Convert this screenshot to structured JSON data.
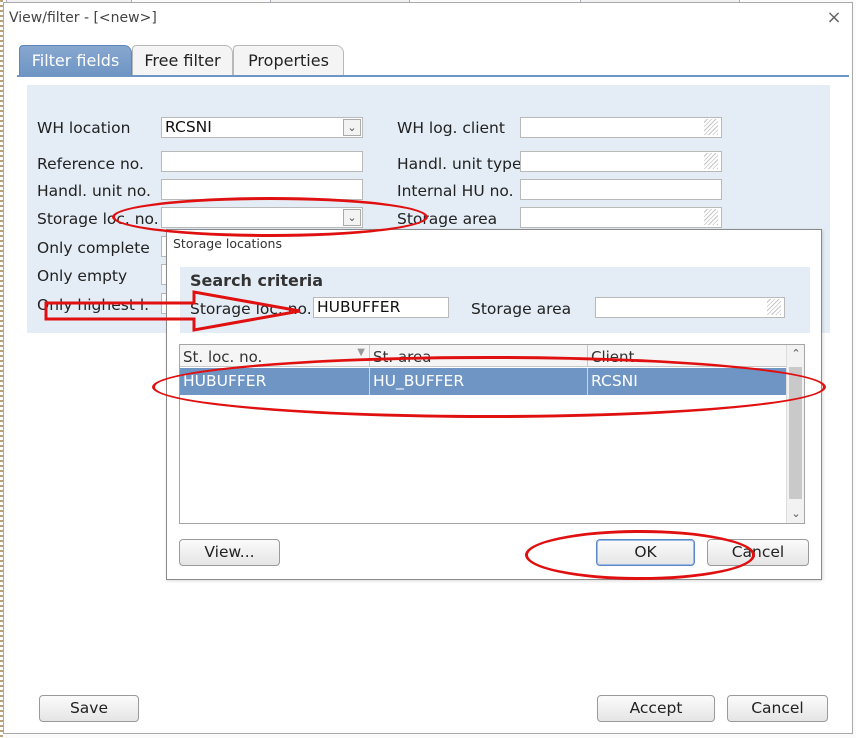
{
  "dialog": {
    "title": "View/filter - [<new>]",
    "close_glyph": "×",
    "tabs": [
      {
        "label": "Filter fields",
        "active": true
      },
      {
        "label": "Free filter",
        "active": false
      },
      {
        "label": "Properties",
        "active": false
      }
    ]
  },
  "filter_fields": {
    "wh_location_label": "WH location",
    "wh_location_value": "RCSNI",
    "reference_no_label": "Reference no.",
    "handl_unit_no_label": "Handl. unit no.",
    "storage_loc_no_label": "Storage loc. no.",
    "only_complete_label": "Only complete",
    "only_empty_label": "Only empty",
    "only_highest_label": "Only highest l.",
    "wh_log_client_label": "WH log. client",
    "handl_unit_type_label": "Handl. unit type",
    "internal_hu_no_label": "Internal HU no.",
    "storage_area_label": "Storage area"
  },
  "storage_locations": {
    "title": "Storage locations",
    "search_criteria_heading": "Search criteria",
    "storage_loc_no_label": "Storage loc. no.",
    "storage_loc_no_value": "HUBUFFER",
    "storage_area_label": "Storage area",
    "columns": [
      "St. loc. no.",
      "St. area",
      "Client"
    ],
    "rows": [
      {
        "st_loc_no": "HUBUFFER",
        "st_area": "HU_BUFFER",
        "client": "RCSNI",
        "selected": true
      }
    ],
    "view_button": "View...",
    "ok_button": "OK",
    "cancel_button": "Cancel"
  },
  "footer": {
    "save_button": "Save",
    "accept_button": "Accept",
    "cancel_button": "Cancel"
  },
  "colors": {
    "accent": "#6f95c4",
    "panel_bg": "#e4edf6",
    "annotation_red": "#e01010"
  }
}
